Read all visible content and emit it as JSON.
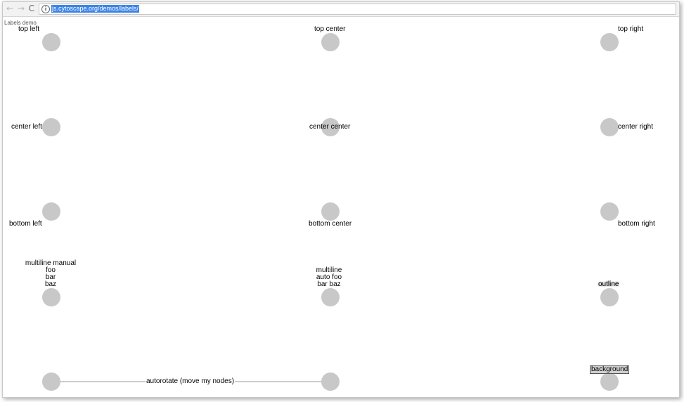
{
  "browser": {
    "back_icon": "←",
    "forward_icon": "→",
    "reload_icon": "C",
    "info_icon": "i",
    "url": "js.cytoscape.org/demos/labels/"
  },
  "page": {
    "title": "Labels demo"
  },
  "labels": {
    "top_left": "top left",
    "top_center": "top center",
    "top_right": "top right",
    "center_left": "center left",
    "center_center": "center center",
    "center_right": "center right",
    "bottom_left": "bottom left",
    "bottom_center": "bottom center",
    "bottom_right": "bottom right",
    "multiline_manual": "multiline manual\nfoo\nbar\nbaz",
    "multiline_auto": "multiline\nauto foo\nbar baz",
    "outline": "outline",
    "background": "background",
    "autorotate": "autorotate (move my nodes)"
  }
}
